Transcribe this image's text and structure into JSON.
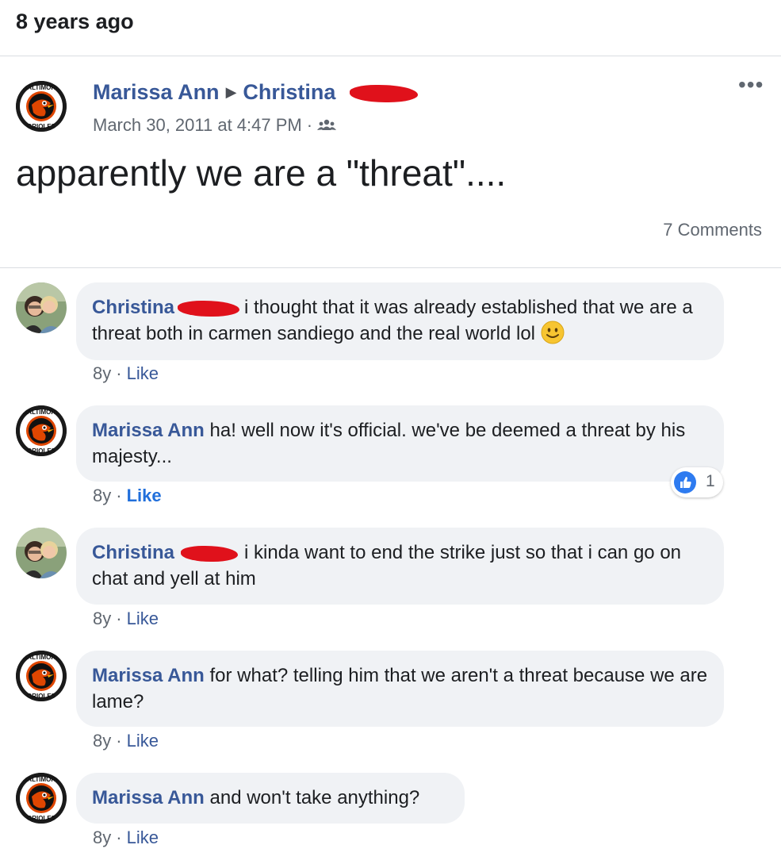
{
  "memory": {
    "title": "8 years ago"
  },
  "post": {
    "author": "Marissa Ann",
    "recipient": "Christina",
    "timestamp": "March 30, 2011 at 4:47 PM",
    "audience_icon": "friends-icon",
    "text": "apparently we are a \"threat\"....",
    "comment_count": "7 Comments",
    "more_icon": "more-options-icon"
  },
  "comments": [
    {
      "author": "Christina",
      "text": "i thought that it was already established that we are a threat both in carmen sandiego and the real world lol",
      "age": "8y",
      "like": "Like",
      "emoji": "slightly-smiling-face"
    },
    {
      "author": "Marissa Ann",
      "text": "ha! well now it's official. we've be deemed a threat by his majesty...",
      "age": "8y",
      "like": "Like",
      "reactions": "1"
    },
    {
      "author": "Christina",
      "text": "i kinda want to end the strike just so that i can go on chat and yell at him",
      "age": "8y",
      "like": "Like"
    },
    {
      "author": "Marissa Ann",
      "text": "for what? telling him that we aren't a threat because we are lame?",
      "age": "8y",
      "like": "Like"
    },
    {
      "author": "Marissa Ann",
      "text": "and won't take anything?",
      "age": "8y",
      "like": "Like"
    }
  ],
  "colors": {
    "link_blue": "#385898",
    "bubble_bg": "#f0f2f5",
    "redaction": "#e0111b",
    "orioles_orange": "#df4601"
  }
}
